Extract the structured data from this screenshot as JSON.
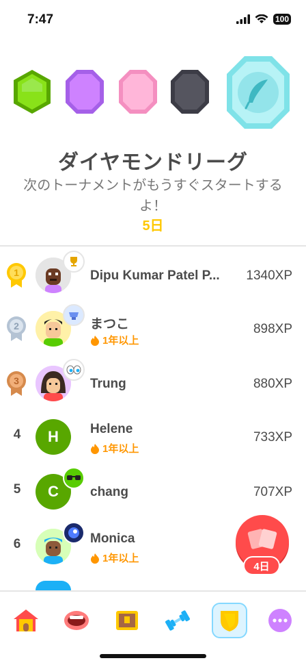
{
  "status_bar": {
    "time": "7:47",
    "battery": "100"
  },
  "league": {
    "title": "ダイヤモンドリーグ",
    "subtitle": "次のトーナメントがもうすぐスタートするよ！",
    "countdown": "5日",
    "tiers": [
      "green-gem-icon",
      "purple-gem-icon",
      "pink-gem-icon",
      "black-gem-icon",
      "diamond-feather-gem-icon"
    ]
  },
  "leaderboard": [
    {
      "rank": "1",
      "name": "Dipu Kumar Patel P...",
      "xp": "1340XP",
      "badge": "trophy-icon"
    },
    {
      "rank": "2",
      "name": "まつこ",
      "streak": "1年以上",
      "xp": "898XP",
      "badge": "cup-icon"
    },
    {
      "rank": "3",
      "name": "Trung",
      "xp": "880XP",
      "badge": "eyes-icon"
    },
    {
      "rank": "4",
      "name": "Helene",
      "streak": "1年以上",
      "xp": "733XP",
      "avatar_letter": "H"
    },
    {
      "rank": "5",
      "name": "chang",
      "xp": "707XP",
      "avatar_letter": "C",
      "badge": "sunglasses-icon"
    },
    {
      "rank": "6",
      "name": "Monica",
      "streak": "1年以上",
      "badge": "orb-icon"
    }
  ],
  "quest_fab": {
    "label": "4日"
  },
  "tabs": [
    "home-tab",
    "speak-tab",
    "treasure-tab",
    "practice-tab",
    "leagues-tab",
    "more-tab"
  ],
  "colors": {
    "gold": "#ffc800",
    "streak": "#ff9600",
    "green": "#58a700",
    "red": "#ff4b4b"
  }
}
